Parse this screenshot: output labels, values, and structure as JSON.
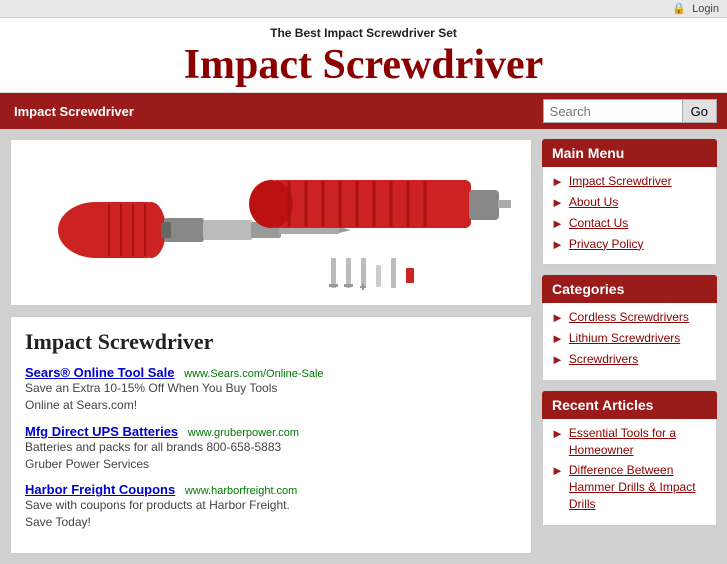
{
  "topbar": {
    "login_label": "Login",
    "login_icon": "🔒"
  },
  "header": {
    "tagline": "The Best Impact Screwdriver Set",
    "title": "Impact Screwdriver"
  },
  "navbar": {
    "nav_item": "Impact Screwdriver",
    "search_placeholder": "Search",
    "search_button_label": "Go"
  },
  "sidebar": {
    "main_menu_header": "Main Menu",
    "main_menu_items": [
      {
        "label": "Impact Screwdriver"
      },
      {
        "label": "About Us"
      },
      {
        "label": "Contact Us"
      },
      {
        "label": "Privacy Policy"
      }
    ],
    "categories_header": "Categories",
    "categories_items": [
      {
        "label": "Cordless Screwdrivers"
      },
      {
        "label": "Lithium Screwdrivers"
      },
      {
        "label": "Screwdrivers"
      }
    ],
    "recent_articles_header": "Recent Articles",
    "recent_articles_items": [
      {
        "label": "Essential Tools for a Homeowner"
      },
      {
        "label": "Difference Between Hammer Drills & Impact Drills"
      }
    ]
  },
  "article": {
    "title": "Impact Screwdriver",
    "ads": [
      {
        "link_text": "Sears® Online Tool Sale",
        "url_text": "www.Sears.com/Online-Sale",
        "desc1": "Save an Extra 10-15% Off When You Buy Tools",
        "desc2": "Online at Sears.com!"
      },
      {
        "link_text": "Mfg Direct UPS Batteries",
        "url_text": "www.gruberpower.com",
        "desc1": "Batteries and packs for all brands 800-658-5883",
        "desc2": "Gruber Power Services"
      },
      {
        "link_text": "Harbor Freight Coupons",
        "url_text": "www.harborfreight.com",
        "desc1": "Save with coupons for products at Harbor Freight.",
        "desc2": "Save Today!"
      }
    ]
  }
}
